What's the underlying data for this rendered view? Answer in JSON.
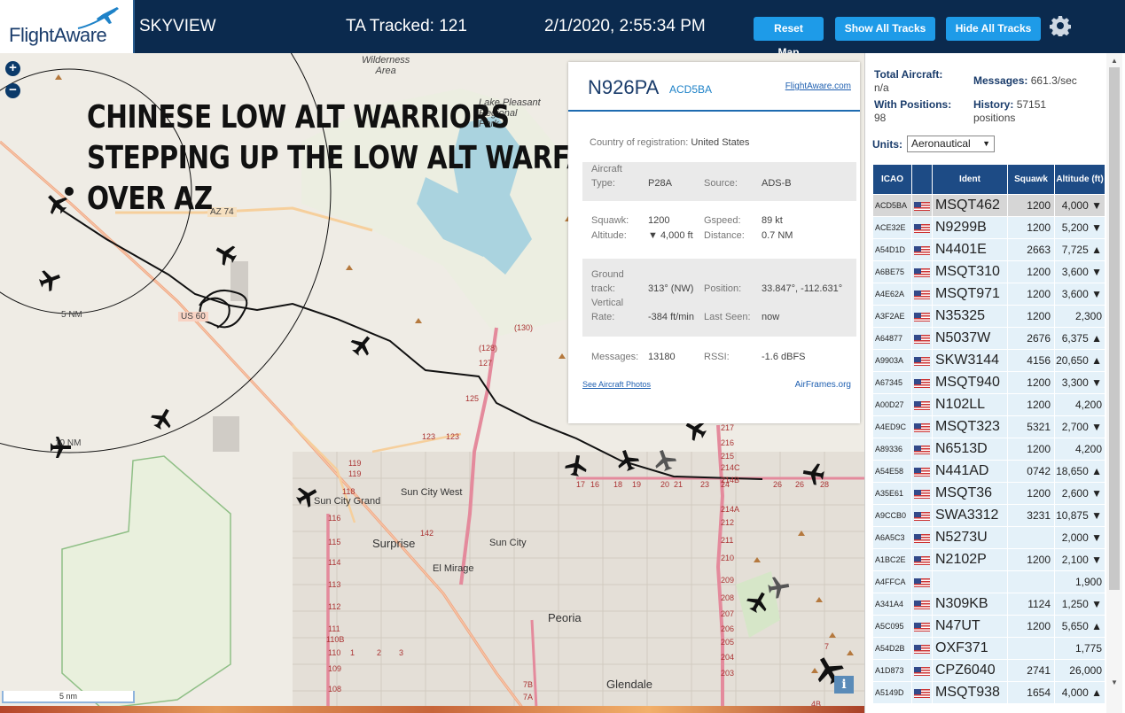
{
  "header": {
    "logo": "FlightAware",
    "app_title": "SKYVIEW",
    "tracked": "TA Tracked: 121",
    "datetime": "2/1/2020, 2:55:34 PM",
    "buttons": {
      "reset": "Reset Map",
      "show_all": "Show All Tracks",
      "hide_all": "Hide All Tracks"
    },
    "settings_icon": "gear-icon"
  },
  "map": {
    "overlay_lines": [
      "CHINESE LOW ALT WARRIORS",
      "STEPPING UP THE LOW ALT WARFARE",
      "OVER AZ"
    ],
    "labels": {
      "wilderness": "Wilderness\nArea",
      "lake_pleasant": "Lake Pleasant\nRegional\nPark",
      "az74": "AZ 74",
      "us60": "US 60",
      "ring5": "5 NM",
      "ring10": "10 NM",
      "sun_city_west": "Sun City West",
      "sun_city_grand": "Sun City Grand",
      "surprise": "Surprise",
      "sun_city": "Sun City",
      "el_mirage": "El Mirage",
      "peoria": "Peoria",
      "glendale": "Glendale"
    },
    "road_numbers": [
      "(130)",
      "(128)",
      "127",
      "125",
      "123",
      "123",
      "119",
      "119",
      "118",
      "116",
      "115",
      "114",
      "113",
      "112",
      "111",
      "110B",
      "110",
      "109",
      "108",
      "1",
      "2",
      "3",
      "142",
      "17",
      "16",
      "18",
      "19",
      "20",
      "21",
      "23",
      "24",
      "26",
      "26",
      "28",
      "217",
      "216",
      "215",
      "214C",
      "214B",
      "214A",
      "212",
      "211",
      "210",
      "209",
      "208",
      "207",
      "206",
      "205",
      "204",
      "203",
      "7B",
      "7A",
      "4B",
      "7"
    ],
    "scale": "5 nm",
    "info_button": "i"
  },
  "popup": {
    "ident": "N926PA",
    "icao": "ACD5BA",
    "fa_link": "FlightAware.com",
    "country_label": "Country of registration:",
    "country": "United States",
    "aircraft_label": "Aircraft",
    "type_label": "Type:",
    "type": "P28A",
    "source_label": "Source:",
    "source": "ADS-B",
    "squawk_label": "Squawk:",
    "squawk": "1200",
    "gspeed_label": "Gspeed:",
    "gspeed": "89 kt",
    "altitude_label": "Altitude:",
    "altitude": "▼ 4,000 ft",
    "distance_label": "Distance:",
    "distance": "0.7 NM",
    "ground_label": "Ground",
    "track_label": "track:",
    "track": "313° (NW)",
    "position_label": "Position:",
    "position": "33.847°, -112.631°",
    "vertical_label": "Vertical",
    "rate_label": "Rate:",
    "rate": "-384 ft/min",
    "lastseen_label": "Last Seen:",
    "lastseen": "now",
    "messages_label": "Messages:",
    "messages": "13180",
    "rssi_label": "RSSI:",
    "rssi": "-1.6 dBFS",
    "photos_link": "See Aircraft Photos",
    "airframes_link": "AirFrames.org"
  },
  "sidebar": {
    "total_label": "Total Aircraft:",
    "total": "n/a",
    "messages_label": "Messages:",
    "messages": "661.3/sec",
    "positions_label": "With Positions:",
    "positions": "98",
    "history_label": "History:",
    "history": "57151",
    "history_unit": "positions",
    "units_label": "Units:",
    "units_value": "Aeronautical",
    "columns": [
      "ICAO",
      "",
      "Ident",
      "Squawk",
      "Altitude (ft)"
    ],
    "rows": [
      [
        "ACD5BA",
        "MSQT462",
        "1200",
        "4,000 ▼"
      ],
      [
        "ACE32E",
        "N9299B",
        "1200",
        "5,200 ▼"
      ],
      [
        "A54D1D",
        "N4401E",
        "2663",
        "7,725 ▲"
      ],
      [
        "A6BE75",
        "MSQT310",
        "1200",
        "3,600 ▼"
      ],
      [
        "A4E62A",
        "MSQT971",
        "1200",
        "3,600 ▼"
      ],
      [
        "A3F2AE",
        "N35325",
        "1200",
        "2,300"
      ],
      [
        "A64877",
        "N5037W",
        "2676",
        "6,375 ▲"
      ],
      [
        "A9903A",
        "SKW3144",
        "4156",
        "20,650 ▲"
      ],
      [
        "A67345",
        "MSQT940",
        "1200",
        "3,300 ▼"
      ],
      [
        "A00D27",
        "N102LL",
        "1200",
        "4,200"
      ],
      [
        "A4ED9C",
        "MSQT323",
        "5321",
        "2,700 ▼"
      ],
      [
        "A89336",
        "N6513D",
        "1200",
        "4,200"
      ],
      [
        "A54E58",
        "N441AD",
        "0742",
        "18,650 ▲"
      ],
      [
        "A35E61",
        "MSQT36",
        "1200",
        "2,600 ▼"
      ],
      [
        "A9CCB0",
        "SWA3312",
        "3231",
        "10,875 ▼"
      ],
      [
        "A6A5C3",
        "N5273U",
        "",
        "2,000 ▼"
      ],
      [
        "A1BC2E",
        "N2102P",
        "1200",
        "2,100 ▼"
      ],
      [
        "A4FFCA",
        "",
        "",
        "1,900"
      ],
      [
        "A341A4",
        "N309KB",
        "1124",
        "1,250 ▼"
      ],
      [
        "A5C095",
        "N47UT",
        "1200",
        "5,650 ▲"
      ],
      [
        "A54D2B",
        "OXF371",
        "",
        "1,775"
      ],
      [
        "A1D873",
        "CPZ6040",
        "2741",
        "26,000"
      ],
      [
        "A5149D",
        "MSQT938",
        "1654",
        "4,000 ▲"
      ]
    ]
  }
}
